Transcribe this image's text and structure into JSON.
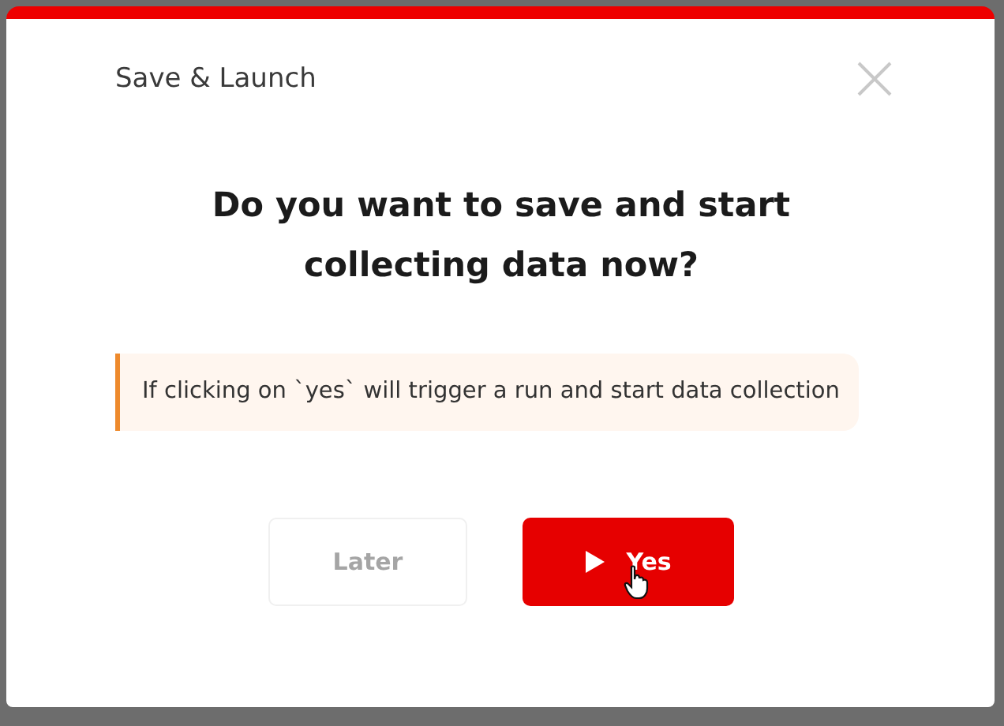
{
  "dialog": {
    "title": "Save & Launch",
    "heading": "Do you want to save and start collecting data now?",
    "note": "If clicking on `yes` will trigger a run and start data collection",
    "buttons": [
      {
        "label": "Later",
        "kind": "secondary"
      },
      {
        "label": "Yes",
        "kind": "primary"
      }
    ]
  }
}
